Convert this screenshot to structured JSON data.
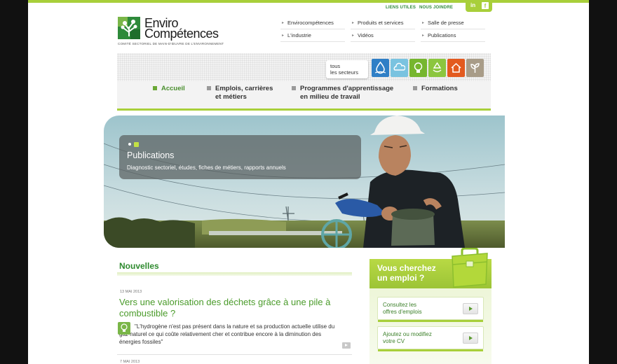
{
  "brand": {
    "name_line1": "Enviro",
    "name_line2": "Compétences",
    "tagline": "COMITÉ SECTORIEL DE MAIN-D'ŒUVRE DE L'ENVIRONNEMENT"
  },
  "utility": {
    "links_label": "LIENS UTILES",
    "contact_label": "NOUS JOINDRE"
  },
  "social": {
    "linkedin": "in",
    "facebook": "f"
  },
  "secondary_menu": [
    "Envirocompétences",
    "Produits et services",
    "Salle de presse",
    "L'industrie",
    "Vidéos",
    "Publications"
  ],
  "sectors": {
    "all_label_line1": "tous",
    "all_label_line2": "les secteurs",
    "icons": [
      {
        "name": "water-drop-icon",
        "color": "#2f7fc6"
      },
      {
        "name": "air-cloud-icon",
        "color": "#7ac3e0"
      },
      {
        "name": "lightbulb-icon",
        "color": "#76b62e"
      },
      {
        "name": "recycling-icon",
        "color": "#8cc63f"
      },
      {
        "name": "house-icon",
        "color": "#e35a1f"
      },
      {
        "name": "plant-icon",
        "color": "#a89c88"
      }
    ]
  },
  "main_nav": [
    {
      "line1": "Accueil",
      "line2": ""
    },
    {
      "line1": "Emplois, carrières",
      "line2": "et métiers"
    },
    {
      "line1": "Programmes d'apprentissage",
      "line2": "en milieu de travail"
    },
    {
      "line1": "Formations",
      "line2": ""
    }
  ],
  "hero": {
    "title": "Publications",
    "subtitle": "Diagnostic sectoriel, études, fiches de métiers, rapports annuels"
  },
  "news": {
    "heading": "Nouvelles",
    "items": [
      {
        "date": "13 MAI 2013",
        "title_line1": "Vers une valorisation des déchets grâce à une pile à",
        "title_line2": "combustible ?",
        "excerpt": "\"L'hydrogène n'est pas présent dans la nature et sa production actuelle utilise du gaz naturel ce qui coûte relativement cher et contribue encore à la diminution des énergies fossiles\""
      },
      {
        "date": "7 MAI 2013"
      }
    ]
  },
  "job_panel": {
    "title_line1": "Vous cherchez",
    "title_line2": "un emploi ?",
    "button1_line1": "Consultez les",
    "button1_line2": "offres d'emplois",
    "button2_line1": "Ajoutez ou modifiez",
    "button2_line2": "votre CV"
  },
  "colors": {
    "accent": "#a8cf3a",
    "green_text": "#4a9b2a",
    "dark_green": "#2e8a2e"
  }
}
